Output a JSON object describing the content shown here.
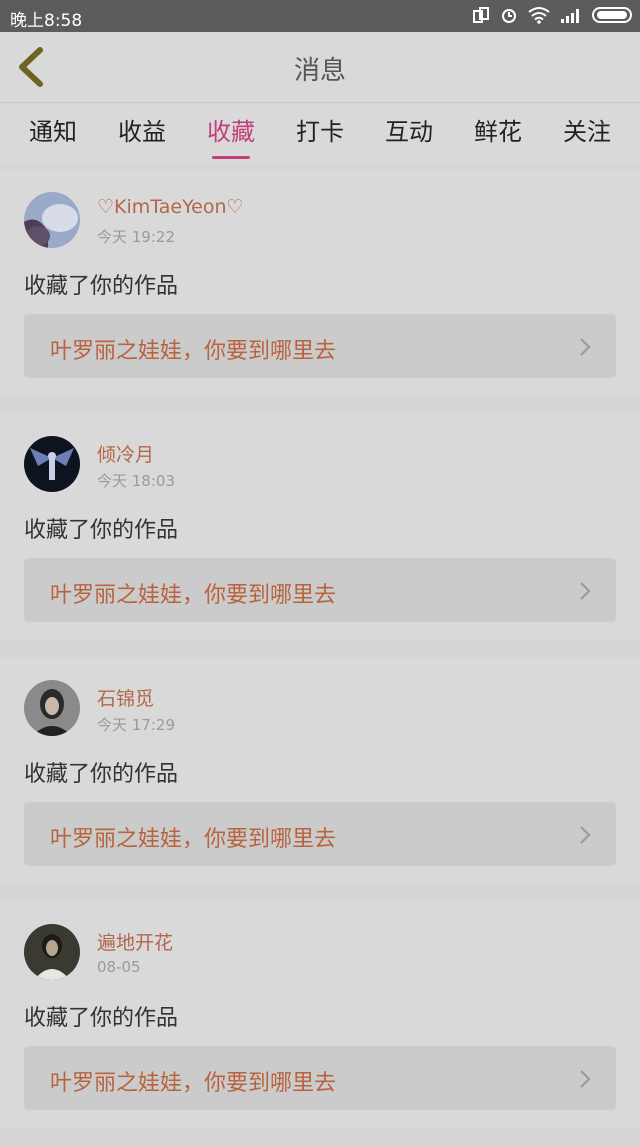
{
  "status_bar": {
    "time": "晚上8:58",
    "icons": [
      "screen-rotate-icon",
      "alarm-icon",
      "wifi-icon",
      "signal-icon",
      "battery-icon"
    ]
  },
  "header": {
    "title": "消息",
    "back_icon": "back-chevron-icon"
  },
  "tabs": [
    {
      "label": "通知"
    },
    {
      "label": "收益"
    },
    {
      "label": "收藏",
      "active": true
    },
    {
      "label": "打卡"
    },
    {
      "label": "互动"
    },
    {
      "label": "鲜花"
    },
    {
      "label": "关注"
    }
  ],
  "items": [
    {
      "user": "♡KimTaeYeon♡",
      "time": "今天 19:22",
      "action": "收藏了你的作品",
      "work": "叶罗丽之娃娃，你要到哪里去"
    },
    {
      "user": "倾冷月",
      "time": "今天 18:03",
      "action": "收藏了你的作品",
      "work": "叶罗丽之娃娃，你要到哪里去"
    },
    {
      "user": "石锦觅",
      "time": "今天 17:29",
      "action": "收藏了你的作品",
      "work": "叶罗丽之娃娃，你要到哪里去"
    },
    {
      "user": "遍地开花",
      "time": "08-05",
      "action": "收藏了你的作品",
      "work": "叶罗丽之娃娃，你要到哪里去"
    }
  ],
  "colors": {
    "accent": "#c0407a",
    "username": "#b2674b",
    "work_title": "#b8633e"
  }
}
